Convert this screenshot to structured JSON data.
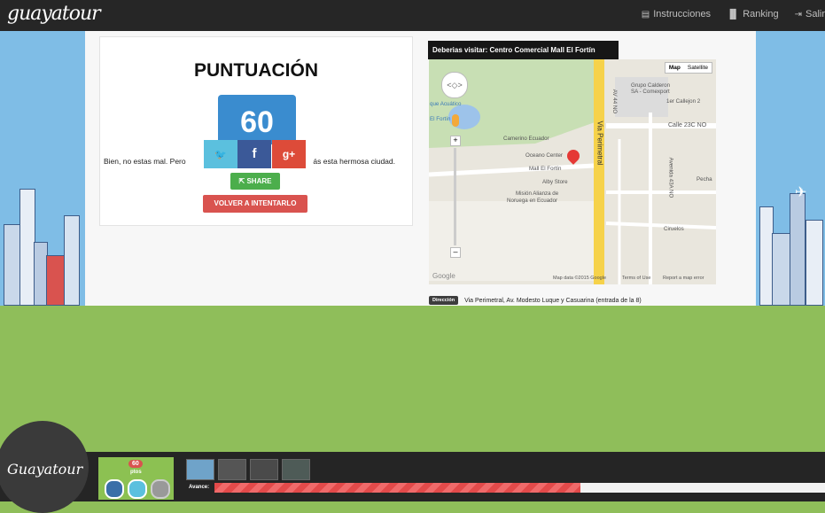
{
  "app": {
    "brand": "guayatour",
    "logo_text": "Guayatour"
  },
  "nav": {
    "items": [
      {
        "label": "Instrucciones",
        "icon": "book-icon"
      },
      {
        "label": "Ranking",
        "icon": "bar-chart-icon"
      },
      {
        "label": "Salir",
        "icon": "sign-out-icon"
      }
    ]
  },
  "score": {
    "title": "PUNTUACIÓN",
    "value": "60",
    "message_left": "Bien, no estas mal. Pero",
    "message_right": "ás esta hermosa ciudad.",
    "social": {
      "twitter": "🐦",
      "facebook": "f",
      "google": "g+"
    },
    "share_label": "SHARE",
    "retry_label": "VOLVER A INTENTARLO"
  },
  "map": {
    "tooltip": "Deberias visitar: Centro Comercial Mall El Fortín",
    "map_type": [
      "Map",
      "Satellite"
    ],
    "labels": {
      "grupo": "Grupo Calderon",
      "comexport": "SA - Comexport",
      "callejon": "1er Callejon 2",
      "calle23": "Calle 23C NO",
      "acuatico": "que Acuático",
      "elfortin": "El Fortín",
      "camerino": "Camerino Ecuador",
      "oceano": "Oceano Center",
      "mall": "Mall El Fortín",
      "alby": "Alby Store",
      "mision": "Misión Alianza de",
      "noruega": "Noruega en Ecuador",
      "via": "Via Perimetral",
      "pecha": "Pecha",
      "ciruelos": "Ciruelos",
      "av44": "AV 44 NO",
      "av43": "Avenida 43A NO",
      "google": "Google",
      "footer_data": "Map data ©2015 Google",
      "footer_terms": "Terms of Use",
      "footer_report": "Report a map error"
    }
  },
  "direccion": {
    "badge": "Dirección",
    "text": "Via Perimetral, Av. Modesto Luque y Casuarina (entrada de la 8)"
  },
  "bottom": {
    "points_value": "60",
    "points_label": "ptos",
    "avance_label": "Avance:",
    "progress": 0.6
  },
  "colors": {
    "accent_blue": "#3a8ccf",
    "twitter": "#5bc0de",
    "facebook": "#3b5998",
    "google": "#dd4b39",
    "share_green": "#4cae4c",
    "retry_red": "#d9534f",
    "progress_red": "#e34a4a"
  }
}
